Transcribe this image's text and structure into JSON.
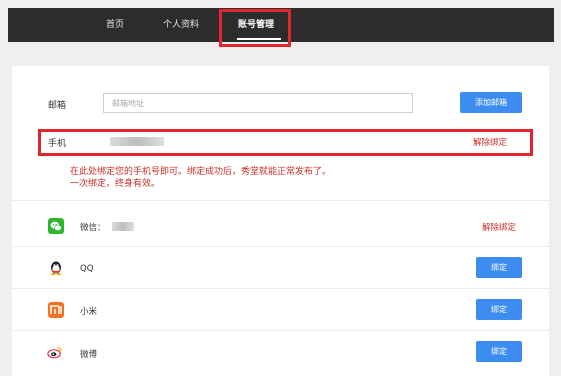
{
  "nav": {
    "items": [
      "首页",
      "个人资料",
      "账号管理"
    ]
  },
  "email": {
    "label": "邮箱",
    "placeholder": "邮箱地址",
    "button": "添加邮箱"
  },
  "phone": {
    "label": "手机",
    "unbind": "解除绑定"
  },
  "notice": {
    "line1": "在此处绑定您的手机号即可。绑定成功后，秀堂就能正常发布了。",
    "line2": "一次绑定，终身有效。"
  },
  "social": [
    {
      "icon": "wechat-icon",
      "name": "微信：",
      "action": "解除绑定"
    },
    {
      "icon": "qq-icon",
      "name": "QQ",
      "action": "绑定"
    },
    {
      "icon": "xiaomi-icon",
      "name": "小米",
      "action": "绑定"
    },
    {
      "icon": "weibo-icon",
      "name": "微博",
      "action": "绑定"
    }
  ],
  "colors": {
    "topbar": "#2c2c2c",
    "highlight": "#e3262d",
    "primary_button": "#3d8df0",
    "link_red": "#c9302c"
  }
}
